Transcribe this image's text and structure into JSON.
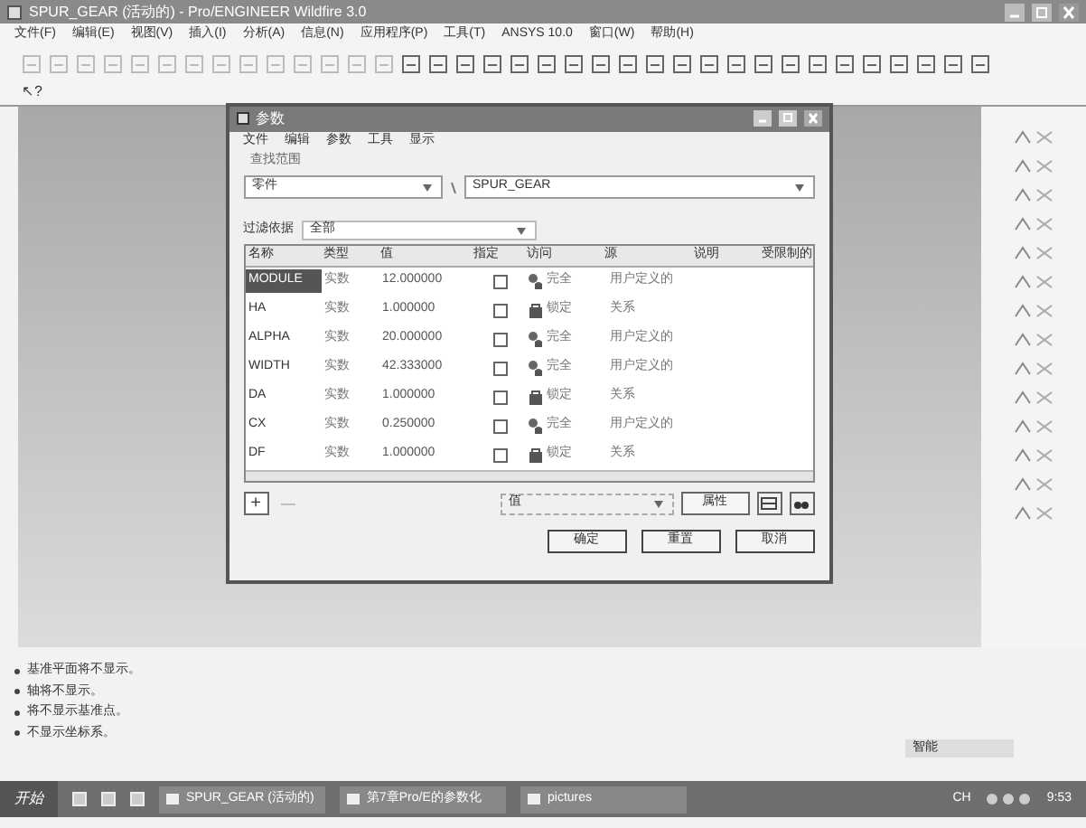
{
  "window": {
    "title": "SPUR_GEAR (活动的) - Pro/ENGINEER Wildfire 3.0"
  },
  "menu": [
    "文件(F)",
    "编辑(E)",
    "视图(V)",
    "插入(I)",
    "分析(A)",
    "信息(N)",
    "应用程序(P)",
    "工具(T)",
    "ANSYS 10.0",
    "窗口(W)",
    "帮助(H)"
  ],
  "help_pointer": "↖?",
  "dialog": {
    "title": "参数",
    "menu": [
      "文件",
      "编辑",
      "参数",
      "工具",
      "显示"
    ],
    "look_in_label": "查找范围",
    "look_in": "零件",
    "model": "SPUR_GEAR",
    "filter_label": "过滤依据",
    "filter": "全部",
    "columns": [
      "名称",
      "类型",
      "值",
      "指定",
      "访问",
      "源",
      "说明",
      "受限制的"
    ],
    "rows": [
      {
        "name": "MODULE",
        "type": "实数",
        "value": "12.000000",
        "designated": false,
        "kind": "full",
        "access_text": "完全",
        "source": "用户定义的",
        "selected": true
      },
      {
        "name": "HA",
        "type": "实数",
        "value": "1.000000",
        "designated": false,
        "kind": "locked",
        "access_text": "锁定",
        "source": "关系",
        "selected": false
      },
      {
        "name": "ALPHA",
        "type": "实数",
        "value": "20.000000",
        "designated": false,
        "kind": "full",
        "access_text": "完全",
        "source": "用户定义的",
        "selected": false
      },
      {
        "name": "WIDTH",
        "type": "实数",
        "value": "42.333000",
        "designated": false,
        "kind": "full",
        "access_text": "完全",
        "source": "用户定义的",
        "selected": false
      },
      {
        "name": "DA",
        "type": "实数",
        "value": "1.000000",
        "designated": false,
        "kind": "locked",
        "access_text": "锁定",
        "source": "关系",
        "selected": false
      },
      {
        "name": "CX",
        "type": "实数",
        "value": "0.250000",
        "designated": false,
        "kind": "full",
        "access_text": "完全",
        "source": "用户定义的",
        "selected": false
      },
      {
        "name": "DF",
        "type": "实数",
        "value": "1.000000",
        "designated": false,
        "kind": "locked",
        "access_text": "锁定",
        "source": "关系",
        "selected": false
      }
    ],
    "add_symbol": "+",
    "remove_symbol": "—",
    "property_select": "值",
    "property_button": "属性",
    "buttons": [
      "确定",
      "重置",
      "取消"
    ]
  },
  "messages": [
    "基准平面将不显示。",
    "轴将不显示。",
    "将不显示基准点。",
    "不显示坐标系。"
  ],
  "filter_field": "智能",
  "taskbar": {
    "start": "开始",
    "tasks": [
      "SPUR_GEAR (活动的)",
      "第7章Pro/E的参数化",
      "pictures"
    ],
    "lang": "CH",
    "clock": "9:53"
  }
}
